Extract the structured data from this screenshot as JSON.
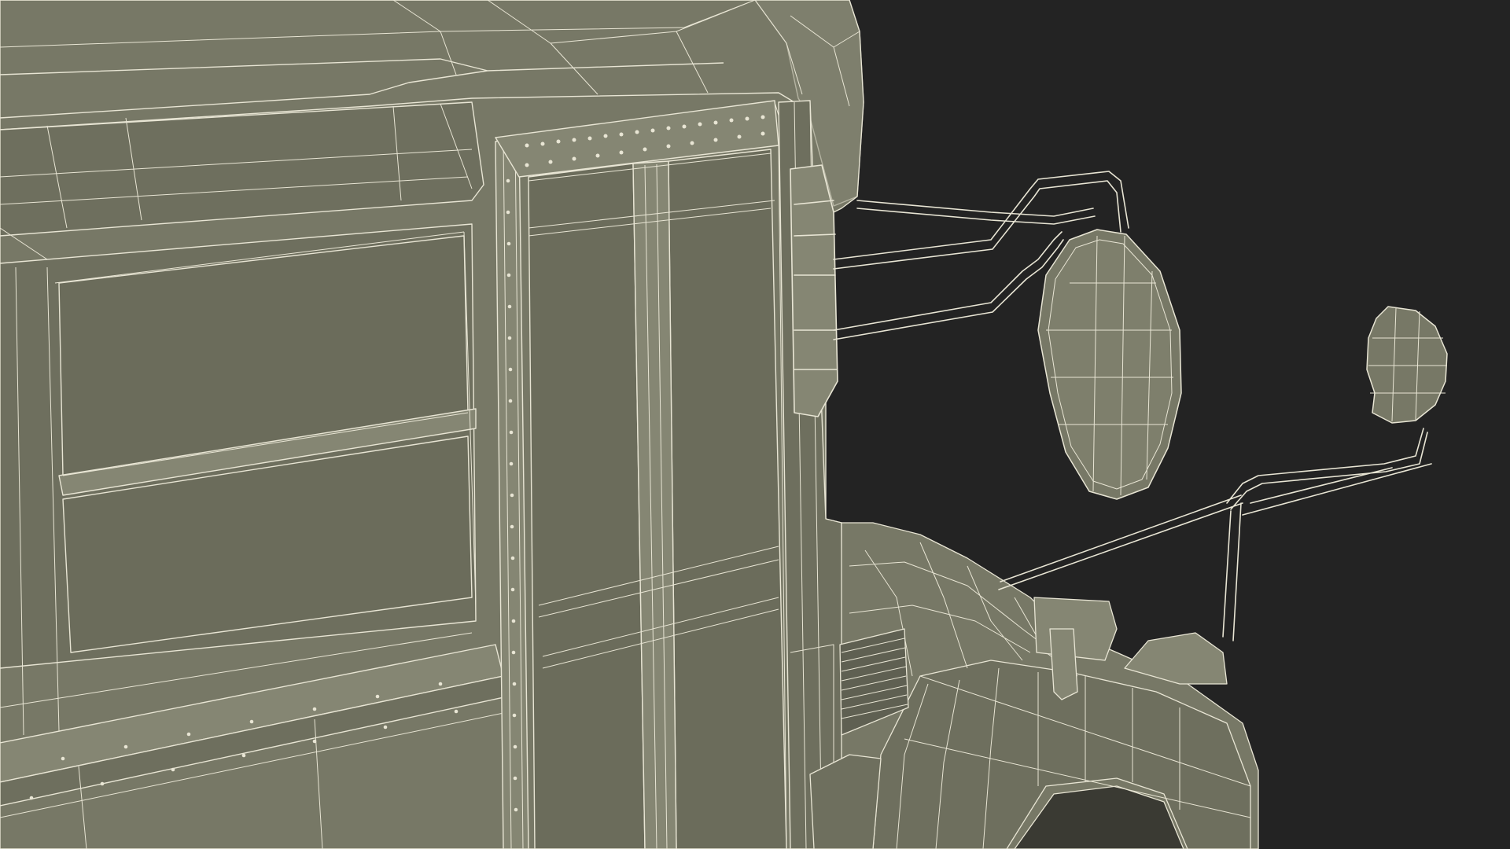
{
  "scene": {
    "subject": "bus-front-corner-wireframe",
    "colors": {
      "background": "#232323",
      "body_fill": "#777866",
      "body_fill_dark": "#66675a",
      "body_fill_light": "#858673",
      "wire": "#e8e5d4",
      "wire_dim": "#c9c6b4"
    }
  }
}
